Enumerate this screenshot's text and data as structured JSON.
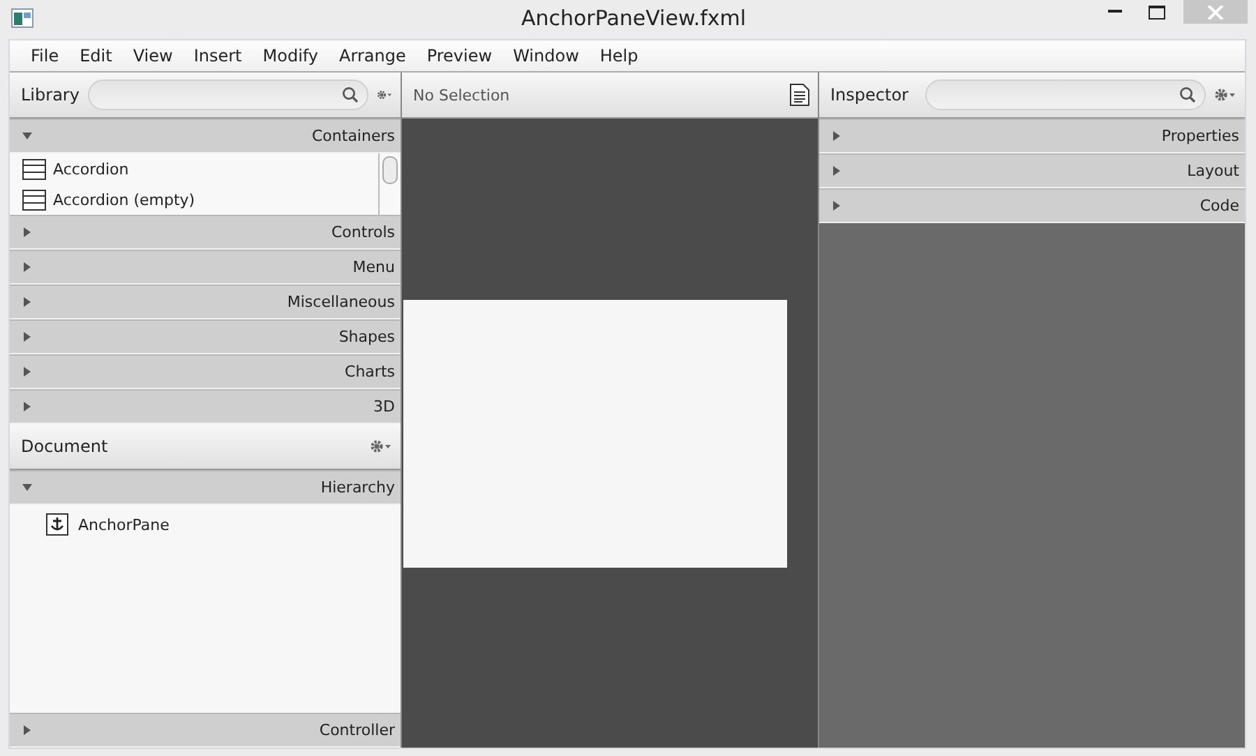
{
  "window": {
    "title": "AnchorPaneView.fxml"
  },
  "menu": [
    "File",
    "Edit",
    "View",
    "Insert",
    "Modify",
    "Arrange",
    "Preview",
    "Window",
    "Help"
  ],
  "library": {
    "title": "Library",
    "sections": [
      {
        "label": "Containers",
        "expanded": true,
        "items": [
          "Accordion",
          "Accordion  (empty)"
        ]
      },
      {
        "label": "Controls",
        "expanded": false
      },
      {
        "label": "Menu",
        "expanded": false
      },
      {
        "label": "Miscellaneous",
        "expanded": false
      },
      {
        "label": "Shapes",
        "expanded": false
      },
      {
        "label": "Charts",
        "expanded": false
      },
      {
        "label": "3D",
        "expanded": false
      }
    ]
  },
  "document": {
    "title": "Document",
    "sections": [
      {
        "label": "Hierarchy",
        "expanded": true,
        "tree": [
          "AnchorPane"
        ]
      }
    ],
    "footer": {
      "label": "Controller",
      "expanded": false
    }
  },
  "content": {
    "selection": "No Selection"
  },
  "inspector": {
    "title": "Inspector",
    "sections": [
      {
        "label": "Properties",
        "expanded": false
      },
      {
        "label": "Layout",
        "expanded": false
      },
      {
        "label": "Code",
        "expanded": false
      }
    ]
  }
}
